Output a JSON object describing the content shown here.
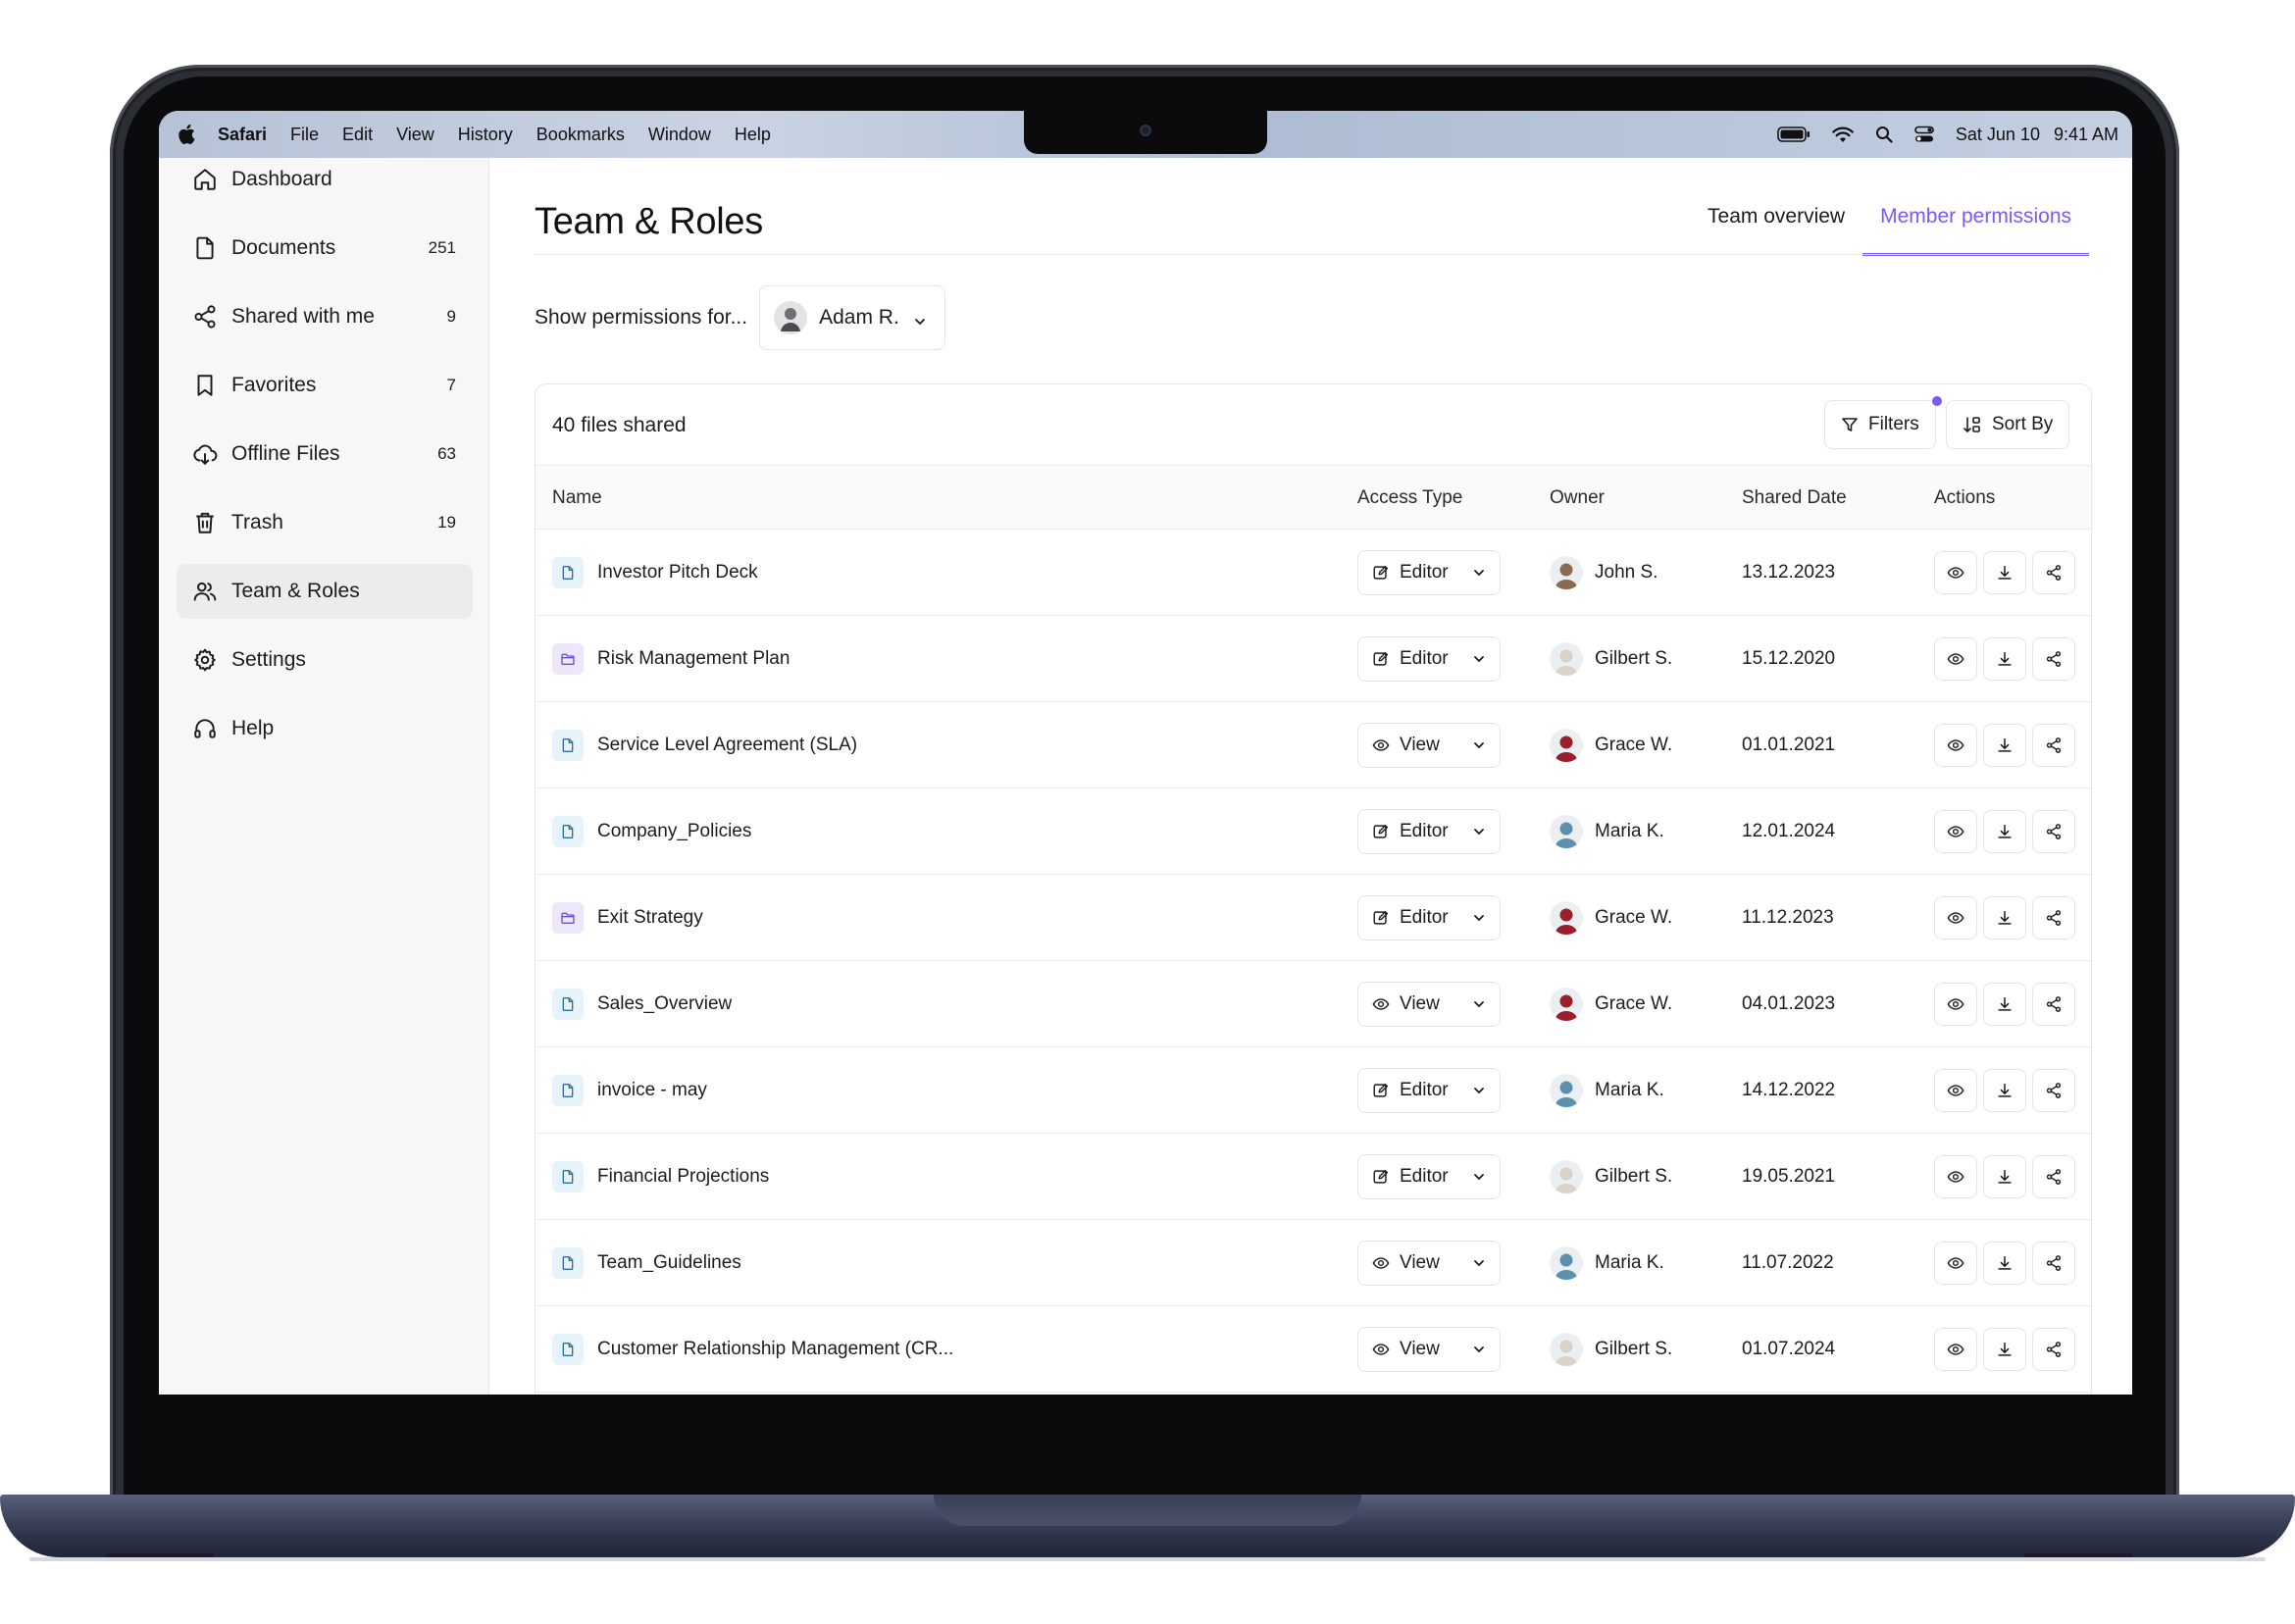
{
  "menubar": {
    "app": "Safari",
    "items": [
      "File",
      "Edit",
      "View",
      "History",
      "Bookmarks",
      "Window",
      "Help"
    ],
    "date": "Sat Jun 10",
    "time": "9:41 AM",
    "icons": [
      "battery-icon",
      "wifi-icon",
      "search-icon",
      "control-center-icon"
    ]
  },
  "sidebar": {
    "items": [
      {
        "label": "Dashboard",
        "icon": "home-icon",
        "count": ""
      },
      {
        "label": "Documents",
        "icon": "document-icon",
        "count": "251"
      },
      {
        "label": "Shared with me",
        "icon": "share-icon",
        "count": "9"
      },
      {
        "label": "Favorites",
        "icon": "bookmark-icon",
        "count": "7"
      },
      {
        "label": "Offline Files",
        "icon": "cloud-offline-icon",
        "count": "63"
      },
      {
        "label": "Trash",
        "icon": "trash-icon",
        "count": "19"
      },
      {
        "label": "Team & Roles",
        "icon": "users-icon",
        "count": "",
        "active": true
      },
      {
        "label": "Settings",
        "icon": "gear-icon",
        "count": ""
      },
      {
        "label": "Help",
        "icon": "headphones-icon",
        "count": ""
      }
    ]
  },
  "page": {
    "title": "Team & Roles",
    "tabs": [
      {
        "label": "Team overview",
        "active": false
      },
      {
        "label": "Member permissions",
        "active": true
      }
    ],
    "permissions_label": "Show permissions for...",
    "selected_user": "Adam R."
  },
  "table": {
    "files_count": "40 files shared",
    "filters_label": "Filters",
    "sort_label": "Sort By",
    "columns": [
      "Name",
      "Access Type",
      "Owner",
      "Shared Date",
      "Actions"
    ],
    "rows": [
      {
        "name": "Investor Pitch Deck",
        "type": "doc",
        "access": "Editor",
        "owner": "John S.",
        "date": "13.12.2023"
      },
      {
        "name": "Risk Management Plan",
        "type": "folder",
        "access": "Editor",
        "owner": "Gilbert S.",
        "date": "15.12.2020"
      },
      {
        "name": "Service Level Agreement (SLA)",
        "type": "doc",
        "access": "View",
        "owner": "Grace W.",
        "date": "01.01.2021"
      },
      {
        "name": "Company_Policies",
        "type": "doc",
        "access": "Editor",
        "owner": "Maria K.",
        "date": "12.01.2024"
      },
      {
        "name": "Exit Strategy",
        "type": "folder",
        "access": "Editor",
        "owner": "Grace W.",
        "date": "11.12.2023"
      },
      {
        "name": "Sales_Overview",
        "type": "doc",
        "access": "View",
        "owner": "Grace W.",
        "date": "04.01.2023"
      },
      {
        "name": "invoice - may",
        "type": "doc",
        "access": "Editor",
        "owner": "Maria K.",
        "date": "14.12.2022"
      },
      {
        "name": "Financial Projections",
        "type": "doc",
        "access": "Editor",
        "owner": "Gilbert S.",
        "date": "19.05.2021"
      },
      {
        "name": "Team_Guidelines",
        "type": "doc",
        "access": "View",
        "owner": "Maria K.",
        "date": "11.07.2022"
      },
      {
        "name": "Customer Relationship Management (CR...",
        "type": "doc",
        "access": "View",
        "owner": "Gilbert S.",
        "date": "01.07.2024"
      }
    ]
  },
  "colors": {
    "accent": "#7a5af5",
    "doc_icon_bg": "#e6f3fa",
    "folder_icon_bg": "#ece7fb",
    "owner_colors": {
      "John S.": "#8a6a52",
      "Gilbert S.": "#d9d3cc",
      "Grace W.": "#9b1f2a",
      "Maria K.": "#5f8fb0"
    }
  }
}
